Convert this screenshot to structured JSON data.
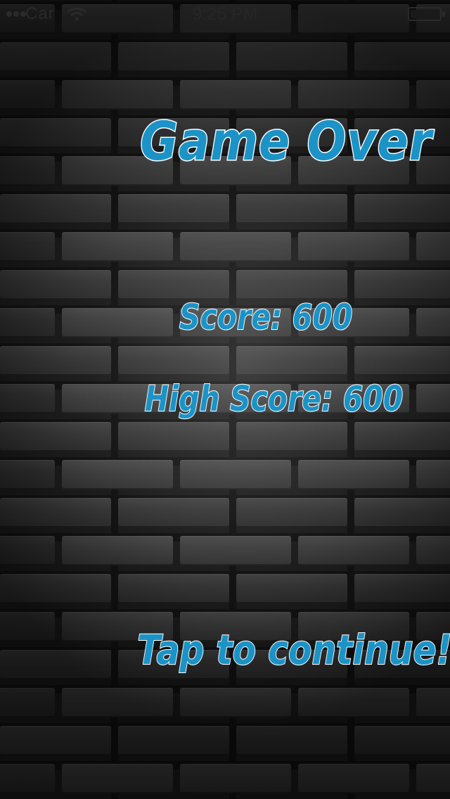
{
  "status_bar": {
    "carrier": "Car",
    "time": "9:25 PM",
    "wifi_icon": "wifi-icon",
    "battery_icon": "battery-icon"
  },
  "game_over": {
    "title": "Game Over",
    "score_label": "Score:",
    "score_value": "600",
    "high_score_label": "High Score:",
    "high_score_value": "600",
    "continue_prompt": "Tap to continue!"
  },
  "colors": {
    "text_fill": "#1c93c6",
    "text_outline": "#ffffff",
    "brick": "#3d3d3d",
    "mortar": "#141414"
  }
}
